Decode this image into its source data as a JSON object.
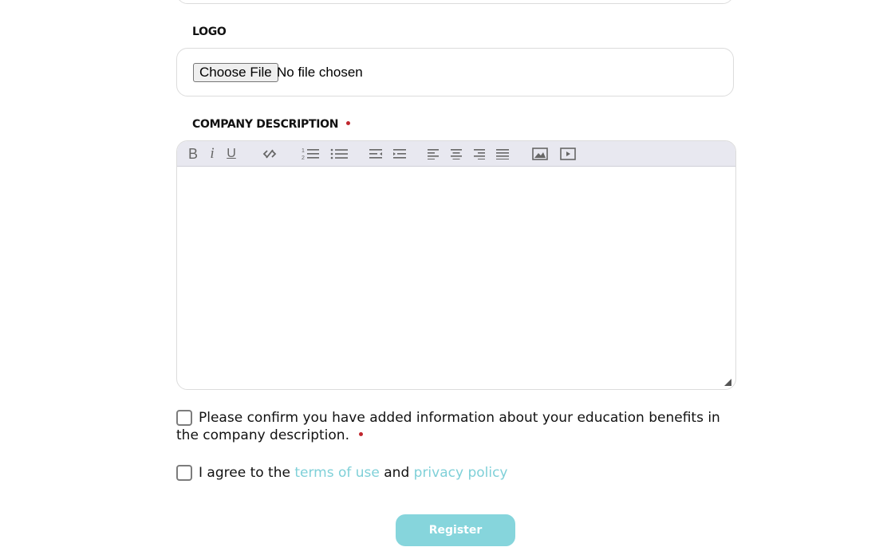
{
  "logo": {
    "label": "LOGO",
    "choose_file_label": "Choose File",
    "file_status": "No file chosen"
  },
  "description": {
    "label": "COMPANY DESCRIPTION",
    "required": true,
    "toolbar": {
      "bold": "B",
      "italic": "i",
      "underline": "U",
      "icons": [
        "bold-icon",
        "italic-icon",
        "underline-icon",
        "unlink-icon",
        "ordered-list-icon",
        "bullet-list-icon",
        "outdent-icon",
        "indent-icon",
        "align-left-icon",
        "align-center-icon",
        "align-right-icon",
        "align-justify-icon",
        "insert-image-icon",
        "insert-video-icon"
      ]
    },
    "content": ""
  },
  "confirm": {
    "text": "Please confirm you have added information about your education benefits in the company description.",
    "required": true
  },
  "agree": {
    "prefix": "I agree to the ",
    "terms_link": "terms of use",
    "middle": " and ",
    "privacy_link": "privacy policy"
  },
  "register": {
    "label": "Register"
  },
  "colors": {
    "accent": "#86d5dc",
    "link": "#7fd0d8",
    "required_dot": "#c0262d",
    "toolbar_bg": "#e8e8f0"
  }
}
